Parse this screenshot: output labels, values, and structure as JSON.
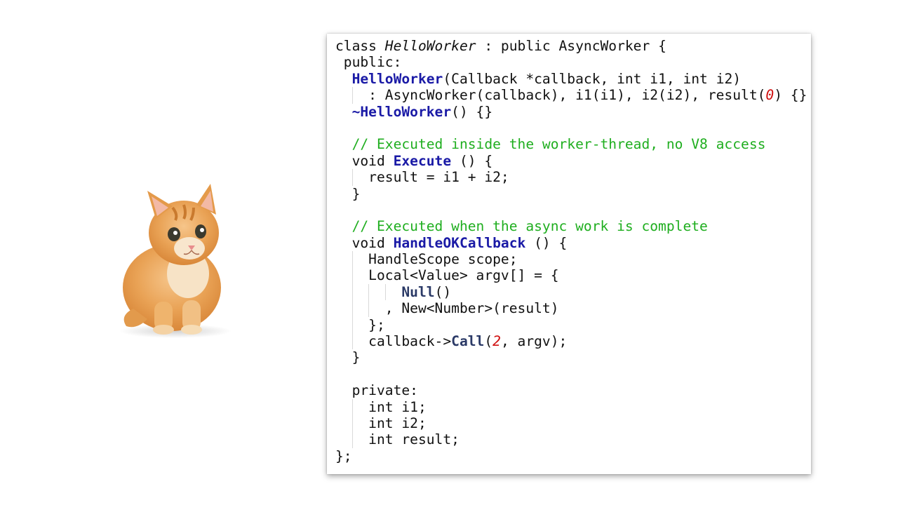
{
  "code": {
    "lines": [
      [
        {
          "t": "class "
        },
        {
          "t": "HelloWorker",
          "c": "it"
        },
        {
          "t": " : public AsyncWorker {"
        }
      ],
      [
        {
          "t": " public:"
        }
      ],
      [
        {
          "t": "  "
        },
        {
          "t": "HelloWorker",
          "c": "fn"
        },
        {
          "t": "(Callback *callback, int i1, int i2)"
        }
      ],
      [
        {
          "t": "    : AsyncWorker(callback), i1(i1), i2(i2), result("
        },
        {
          "t": "0",
          "c": "num"
        },
        {
          "t": ") {}"
        }
      ],
      [
        {
          "t": "  "
        },
        {
          "t": "~HelloWorker",
          "c": "fn"
        },
        {
          "t": "() {}"
        }
      ],
      [
        {
          "t": ""
        }
      ],
      [
        {
          "t": "  "
        },
        {
          "t": "// Executed inside the worker-thread, no V8 access",
          "c": "cm"
        }
      ],
      [
        {
          "t": "  void "
        },
        {
          "t": "Execute",
          "c": "fn"
        },
        {
          "t": " () {"
        }
      ],
      [
        {
          "t": "    result = i1 + i2;"
        }
      ],
      [
        {
          "t": "  }"
        }
      ],
      [
        {
          "t": ""
        }
      ],
      [
        {
          "t": "  "
        },
        {
          "t": "// Executed when the async work is complete",
          "c": "cm"
        }
      ],
      [
        {
          "t": "  void "
        },
        {
          "t": "HandleOKCallback",
          "c": "fn"
        },
        {
          "t": " () {"
        }
      ],
      [
        {
          "t": "    HandleScope scope;"
        }
      ],
      [
        {
          "t": "    Local<Value> argv[] = {"
        }
      ],
      [
        {
          "t": "        "
        },
        {
          "t": "Null",
          "c": "fn2"
        },
        {
          "t": "()"
        }
      ],
      [
        {
          "t": "      , New<Number>(result)"
        }
      ],
      [
        {
          "t": "    };"
        }
      ],
      [
        {
          "t": "    callback->"
        },
        {
          "t": "Call",
          "c": "fn2"
        },
        {
          "t": "("
        },
        {
          "t": "2",
          "c": "num"
        },
        {
          "t": ", argv);"
        }
      ],
      [
        {
          "t": "  }"
        }
      ],
      [
        {
          "t": ""
        }
      ],
      [
        {
          "t": "  private:"
        }
      ],
      [
        {
          "t": "    int i1;"
        }
      ],
      [
        {
          "t": "    int i2;"
        }
      ],
      [
        {
          "t": "    int result;"
        }
      ],
      [
        {
          "t": "};"
        }
      ]
    ]
  },
  "colors": {
    "function": "#1a1aa6",
    "comment": "#1fae1f",
    "number": "#d01010",
    "text": "#111111"
  },
  "image": {
    "icon": "kitten-illustration"
  }
}
